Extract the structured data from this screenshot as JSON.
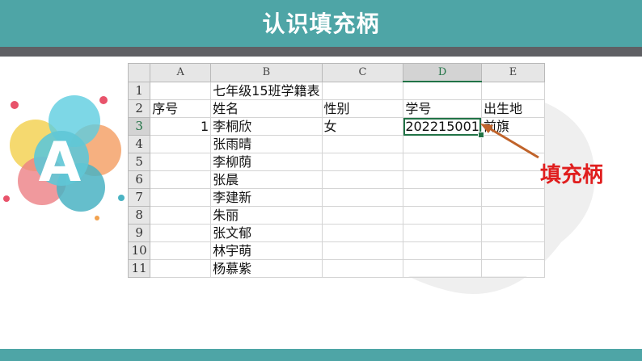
{
  "slide": {
    "title": "认识填充柄",
    "badge_letter": "A",
    "callout_label": "填充柄",
    "colors": {
      "teal": "#4ea5a6",
      "dark_bar": "#5f6064",
      "callout": "#e01e1e",
      "arrow": "#c0632a",
      "excel_green": "#217346"
    }
  },
  "spreadsheet": {
    "columns": [
      "A",
      "B",
      "C",
      "D",
      "E"
    ],
    "selected_column": "D",
    "selected_row": "3",
    "rows": [
      {
        "num": "1",
        "cells": [
          "",
          "七年级15班学籍表",
          "",
          "",
          ""
        ]
      },
      {
        "num": "2",
        "cells": [
          "序号",
          "姓名",
          "性别",
          "学号",
          "出生地"
        ]
      },
      {
        "num": "3",
        "cells": [
          "1",
          "李桐欣",
          "女",
          "202215001",
          "前旗"
        ]
      },
      {
        "num": "4",
        "cells": [
          "",
          "张雨晴",
          "",
          "",
          ""
        ]
      },
      {
        "num": "5",
        "cells": [
          "",
          "李柳荫",
          "",
          "",
          ""
        ]
      },
      {
        "num": "6",
        "cells": [
          "",
          "张晨",
          "",
          "",
          ""
        ]
      },
      {
        "num": "7",
        "cells": [
          "",
          "李建新",
          "",
          "",
          ""
        ]
      },
      {
        "num": "8",
        "cells": [
          "",
          "朱丽",
          "",
          "",
          ""
        ]
      },
      {
        "num": "9",
        "cells": [
          "",
          "张文郁",
          "",
          "",
          ""
        ]
      },
      {
        "num": "10",
        "cells": [
          "",
          "林宇萌",
          "",
          "",
          ""
        ]
      },
      {
        "num": "11",
        "cells": [
          "",
          "杨慕紫",
          "",
          "",
          ""
        ]
      }
    ]
  }
}
